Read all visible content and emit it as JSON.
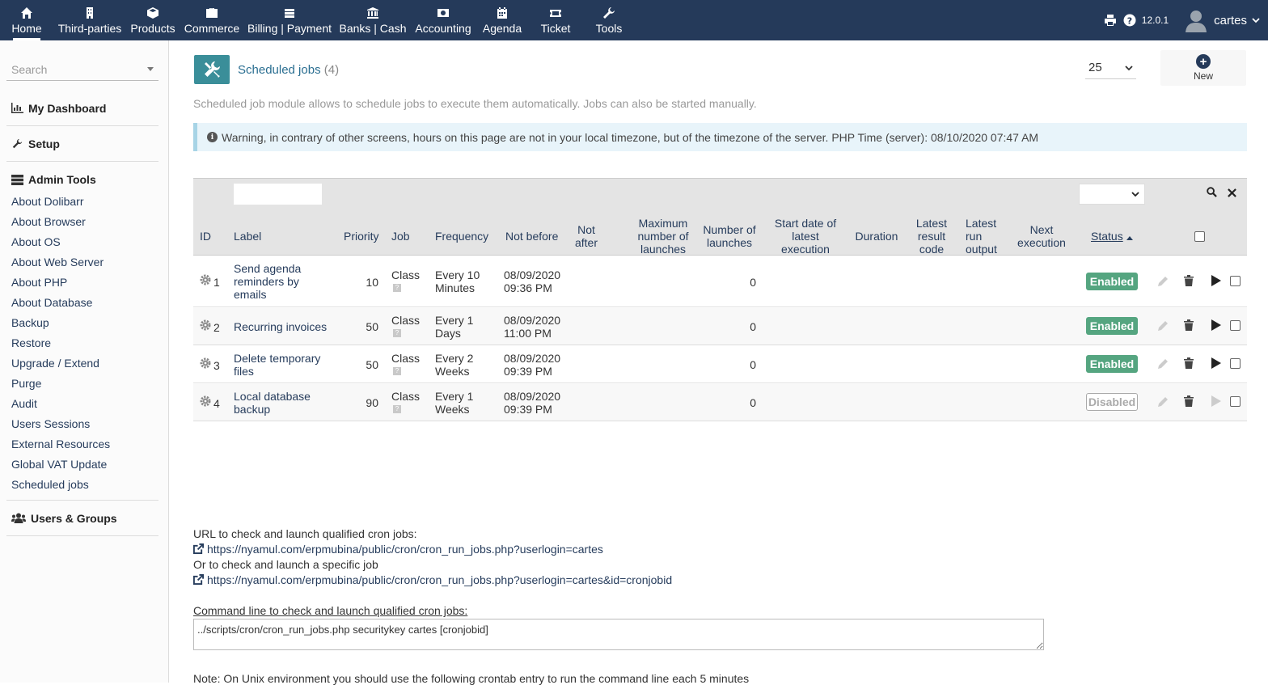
{
  "nav": {
    "items": [
      {
        "label": "Home",
        "icon": "home-icon"
      },
      {
        "label": "Third-parties",
        "icon": "building-icon"
      },
      {
        "label": "Products",
        "icon": "cube-icon"
      },
      {
        "label": "Commerce",
        "icon": "briefcase-icon"
      },
      {
        "label": "Billing | Payment",
        "icon": "money-icon"
      },
      {
        "label": "Banks | Cash",
        "icon": "bank-icon"
      },
      {
        "label": "Accounting",
        "icon": "money-bill-icon"
      },
      {
        "label": "Agenda",
        "icon": "calendar-icon"
      },
      {
        "label": "Ticket",
        "icon": "ticket-icon"
      },
      {
        "label": "Tools",
        "icon": "wrench-icon"
      }
    ],
    "version": "12.0.1",
    "username": "cartes"
  },
  "sidebar": {
    "search_placeholder": "Search",
    "dashboard": "My Dashboard",
    "setup": "Setup",
    "admin_tools": "Admin Tools",
    "admin_items": [
      "About Dolibarr",
      "About Browser",
      "About OS",
      "About Web Server",
      "About PHP",
      "About Database",
      "Backup",
      "Restore",
      "Upgrade / Extend",
      "Purge",
      "Audit",
      "Users Sessions",
      "External Resources",
      "Global VAT Update",
      "Scheduled jobs"
    ],
    "users_groups": "Users & Groups"
  },
  "page": {
    "title": "Scheduled jobs",
    "count": "(4)",
    "limit": "25",
    "new_label": "New",
    "description": "Scheduled job module allows to schedule jobs to execute them automatically. Jobs can also be started manually.",
    "warning": "Warning, in contrary of other screens, hours on this page are not in your local timezone, but of the timezone of the server. PHP Time (server): 08/10/2020 07:47 AM"
  },
  "table": {
    "headers": {
      "id": "ID",
      "label": "Label",
      "priority": "Priority",
      "job": "Job",
      "frequency": "Frequency",
      "not_before": "Not before",
      "not_after_1": "Not",
      "not_after_2": "after",
      "max_1": "Maximum",
      "max_2": "number of",
      "max_3": "launches",
      "num_1": "Number of",
      "num_2": "launches",
      "start_1": "Start date of",
      "start_2": "latest",
      "start_3": "execution",
      "duration": "Duration",
      "result_1": "Latest",
      "result_2": "result",
      "result_3": "code",
      "output_1": "Latest",
      "output_2": "run",
      "output_3": "output",
      "next_1": "Next",
      "next_2": "execution",
      "status": "Status"
    },
    "rows": [
      {
        "id": "1",
        "label": [
          "Send agenda",
          "reminders by",
          "emails"
        ],
        "priority": "10",
        "job": "Class",
        "frequency": [
          "Every 10",
          "Minutes"
        ],
        "not_before": [
          "08/09/2020",
          "09:36 PM"
        ],
        "launches": "0",
        "status": "Enabled"
      },
      {
        "id": "2",
        "label": [
          "Recurring invoices"
        ],
        "priority": "50",
        "job": "Class",
        "frequency": [
          "Every 1",
          "Days"
        ],
        "not_before": [
          "08/09/2020",
          "11:00 PM"
        ],
        "launches": "0",
        "status": "Enabled"
      },
      {
        "id": "3",
        "label": [
          "Delete temporary",
          "files"
        ],
        "priority": "50",
        "job": "Class",
        "frequency": [
          "Every 2",
          "Weeks"
        ],
        "not_before": [
          "08/09/2020",
          "09:39 PM"
        ],
        "launches": "0",
        "status": "Enabled"
      },
      {
        "id": "4",
        "label": [
          "Local database",
          "backup"
        ],
        "priority": "90",
        "job": "Class",
        "frequency": [
          "Every 1",
          "Weeks"
        ],
        "not_before": [
          "08/09/2020",
          "09:39 PM"
        ],
        "launches": "0",
        "status": "Disabled"
      }
    ]
  },
  "bottom": {
    "url_intro": "URL to check and launch qualified cron jobs:",
    "url1": "https://nyamul.com/erpmubina/public/cron/cron_run_jobs.php?userlogin=cartes",
    "specific_intro": "Or to check and launch a specific job",
    "url2": "https://nyamul.com/erpmubina/public/cron/cron_run_jobs.php?userlogin=cartes&id=cronjobid",
    "cmd_intro": "Command line to check and launch qualified cron jobs:",
    "cmd": "../scripts/cron/cron_run_jobs.php securitykey cartes [cronjobid]",
    "note": "Note: On Unix environment you should use the following crontab entry to run the command line each 5 minutes"
  },
  "colors": {
    "topbar": "#253a5a",
    "enabled": "#55a580",
    "title_icon": "#3a8e99"
  }
}
